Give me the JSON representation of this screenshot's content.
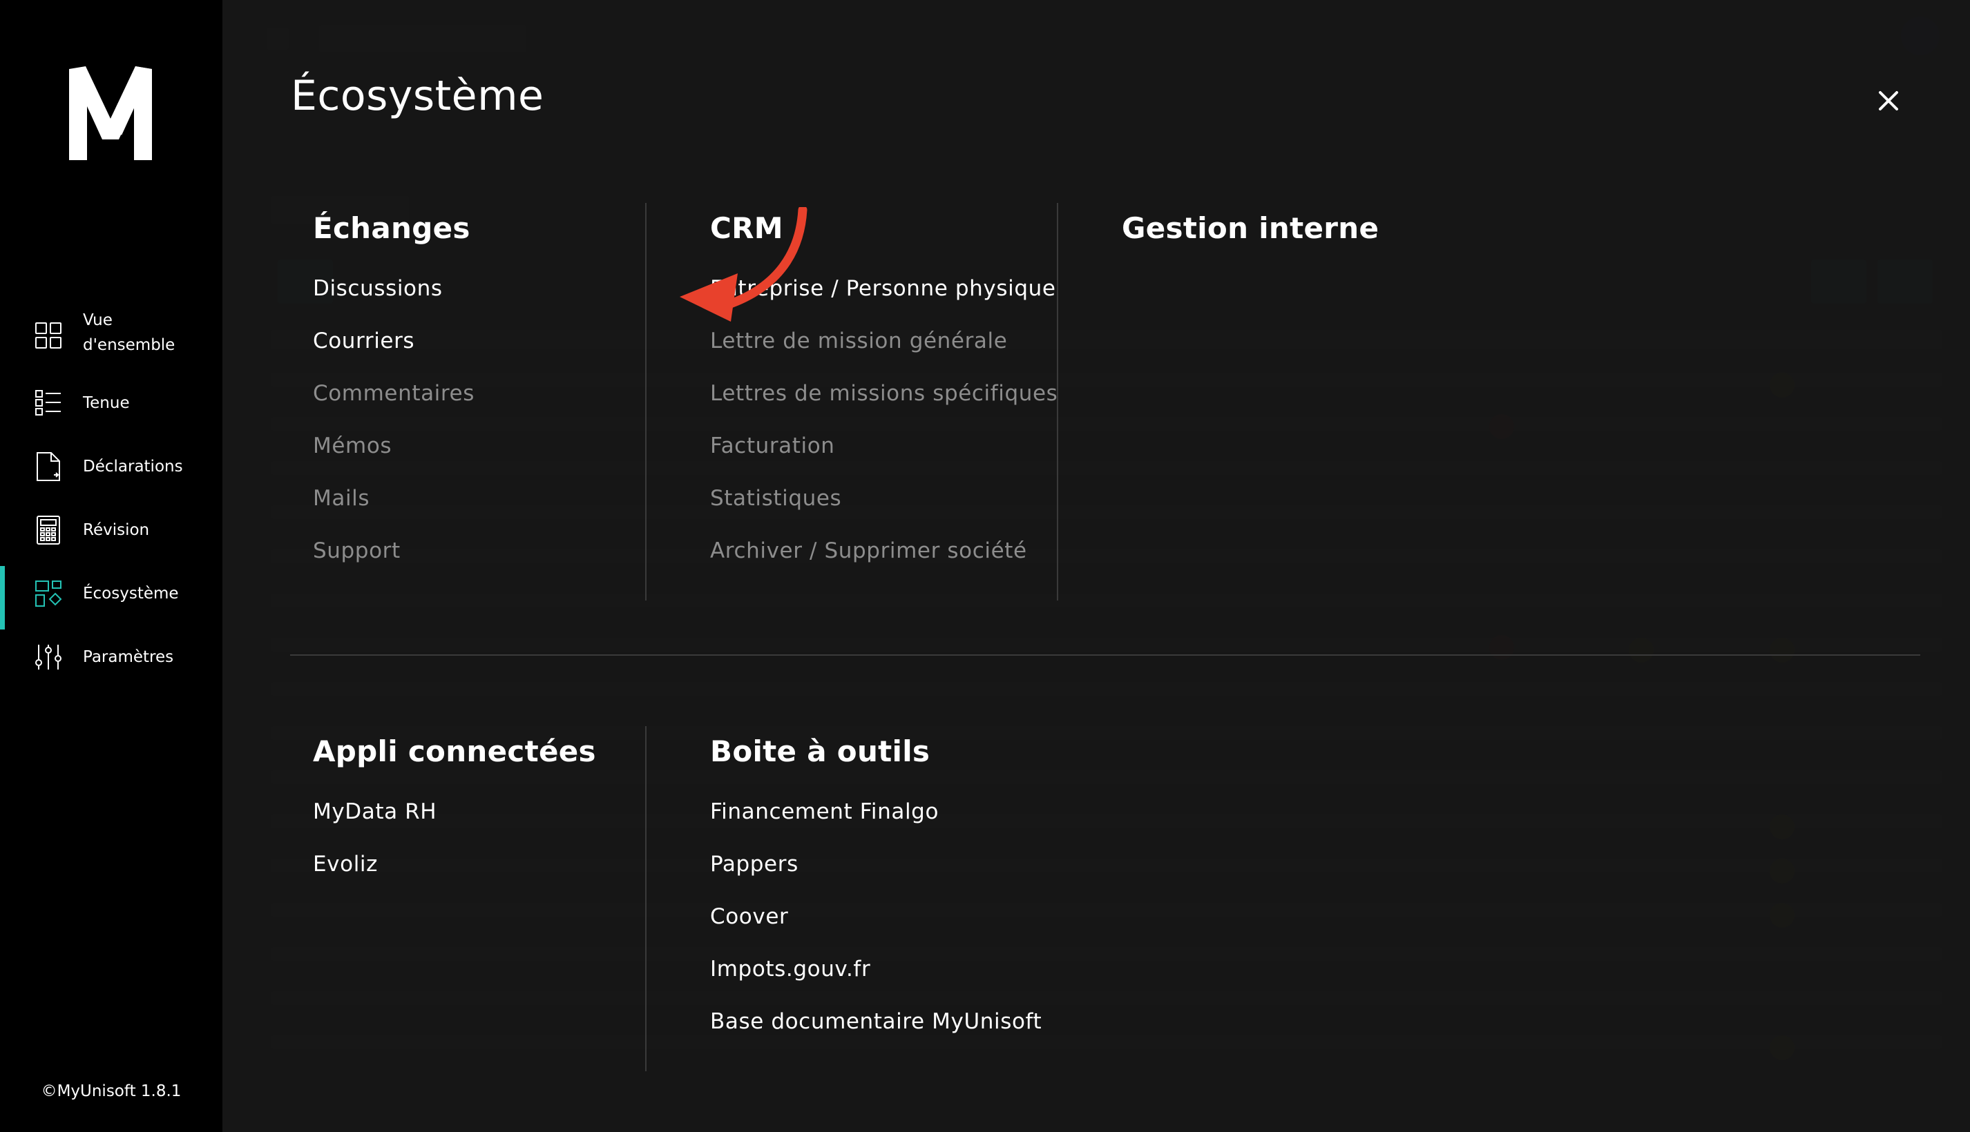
{
  "app": {
    "copyright": "©MyUnisoft 1.8.1"
  },
  "sidebar": {
    "items": [
      {
        "label_line1": "Vue",
        "label_line2": "d'ensemble",
        "icon": "grid-icon"
      },
      {
        "label": "Tenue",
        "icon": "list-icon"
      },
      {
        "label": "Déclarations",
        "icon": "document-icon"
      },
      {
        "label": "Révision",
        "icon": "calculator-icon"
      },
      {
        "label": "Écosystème",
        "icon": "ecosystem-icon",
        "active": true
      },
      {
        "label": "Paramètres",
        "icon": "sliders-icon"
      }
    ]
  },
  "modal": {
    "title": "Écosystème",
    "sections": {
      "echanges": {
        "title": "Échanges",
        "items": [
          "Discussions",
          "Courriers",
          "Commentaires",
          "Mémos",
          "Mails",
          "Support"
        ]
      },
      "crm": {
        "title": "CRM",
        "items": [
          "Entreprise / Personne physique",
          "Lettre de mission générale",
          "Lettres de missions spécifiques",
          "Facturation",
          "Statistiques",
          "Archiver / Supprimer société"
        ]
      },
      "gestion": {
        "title": "Gestion interne"
      },
      "appli": {
        "title": "Appli connectées",
        "items": [
          "MyData RH",
          "Evoliz"
        ]
      },
      "outils": {
        "title": "Boite à outils",
        "items": [
          "Financement Finalgo",
          "Pappers",
          "Coover",
          "Impots.gouv.fr",
          "Base documentaire MyUnisoft"
        ]
      }
    }
  },
  "colors": {
    "accent": "#24c3b5",
    "arrow": "#e8412c",
    "disabled_text": "#8d8d8d"
  }
}
